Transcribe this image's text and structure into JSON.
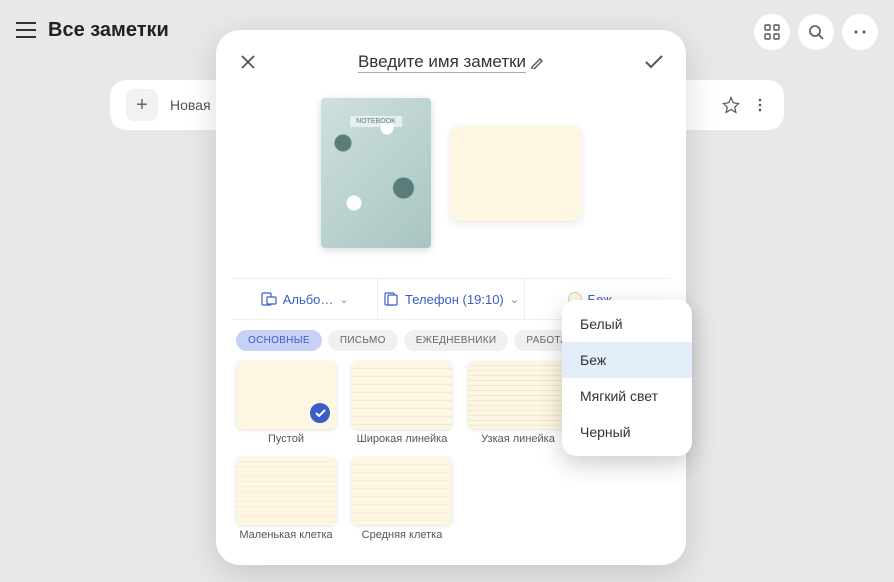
{
  "header": {
    "title": "Все заметки"
  },
  "bgCard": {
    "newLabel": "Новая"
  },
  "modal": {
    "titlePlaceholder": "Введите имя заметки",
    "coverLabel": "NOTEBOOK",
    "options": {
      "orientation": "Альбо…",
      "ratio": "Телефон (19:10)",
      "color": "Беж"
    },
    "tabs": [
      "ОСНОВНЫЕ",
      "ПИСЬМО",
      "ЕЖЕДНЕВНИКИ",
      "РАБОТА"
    ],
    "activeTab": 0,
    "templates": [
      {
        "label": "Пустой",
        "kind": "blank",
        "selected": true
      },
      {
        "label": "Широкая линейка",
        "kind": "wide-lines",
        "selected": false
      },
      {
        "label": "Узкая линейка",
        "kind": "narrow-lines",
        "selected": false
      },
      {
        "label": "Маленькая клетка",
        "kind": "small-grid",
        "selected": false
      },
      {
        "label": "Средняя клетка",
        "kind": "med-grid",
        "selected": false
      }
    ]
  },
  "colorDropdown": {
    "options": [
      "Белый",
      "Беж",
      "Мягкий свет",
      "Черный"
    ],
    "selected": "Беж"
  }
}
